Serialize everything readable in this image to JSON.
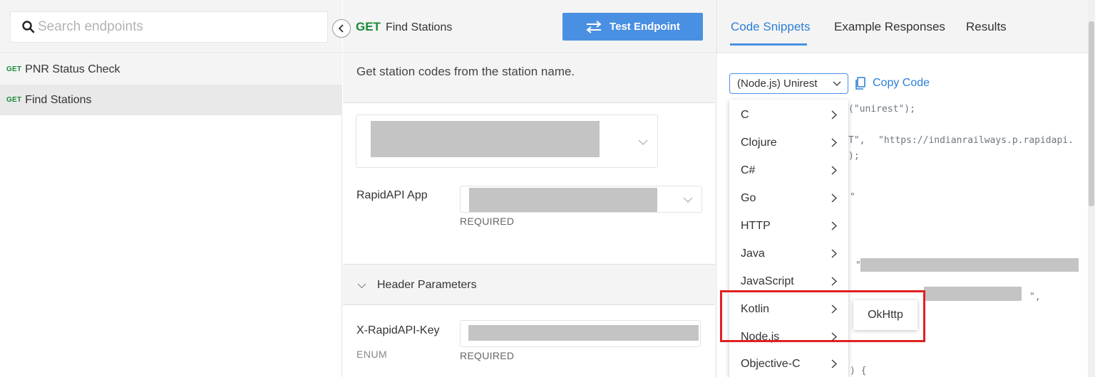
{
  "search": {
    "placeholder": "Search endpoints",
    "icon": "search-icon"
  },
  "sidebar": {
    "items": [
      {
        "method": "GET",
        "label": "PNR Status Check"
      },
      {
        "method": "GET",
        "label": "Find Stations"
      }
    ]
  },
  "endpoint": {
    "method": "GET",
    "name": "Find Stations",
    "description": "Get station codes from the station name.",
    "test_button": "Test Endpoint"
  },
  "form": {
    "app_label": "RapidAPI App",
    "app_required": "REQUIRED",
    "header_params_label": "Header Parameters",
    "key_label": "X-RapidAPI-Key",
    "key_type": "ENUM",
    "key_required": "REQUIRED"
  },
  "right": {
    "tabs": [
      "Code Snippets",
      "Example Responses",
      "Results"
    ],
    "active_tab": "Code Snippets",
    "language_selected": "(Node.js) Unirest",
    "copy_label": "Copy Code",
    "languages": [
      "C",
      "Clojure",
      "C#",
      "Go",
      "HTTP",
      "Java",
      "JavaScript",
      "Kotlin",
      "Node.js",
      "Objective-C"
    ],
    "submenu_item": "OkHttp",
    "code_fragments": {
      "line1": "(\"unirest\");",
      "line2_a": "T\", ",
      "line2_b": "\"https://indianrailways.p.rapidapi.",
      "line3": ");",
      "line4": "\"",
      "line5": "\"",
      "line6": "\",",
      "line7": ") {"
    }
  },
  "colors": {
    "accent": "#4a90e2",
    "get_green": "#1a8a3a",
    "highlight": "#e02020",
    "link": "#2b7fd4"
  }
}
